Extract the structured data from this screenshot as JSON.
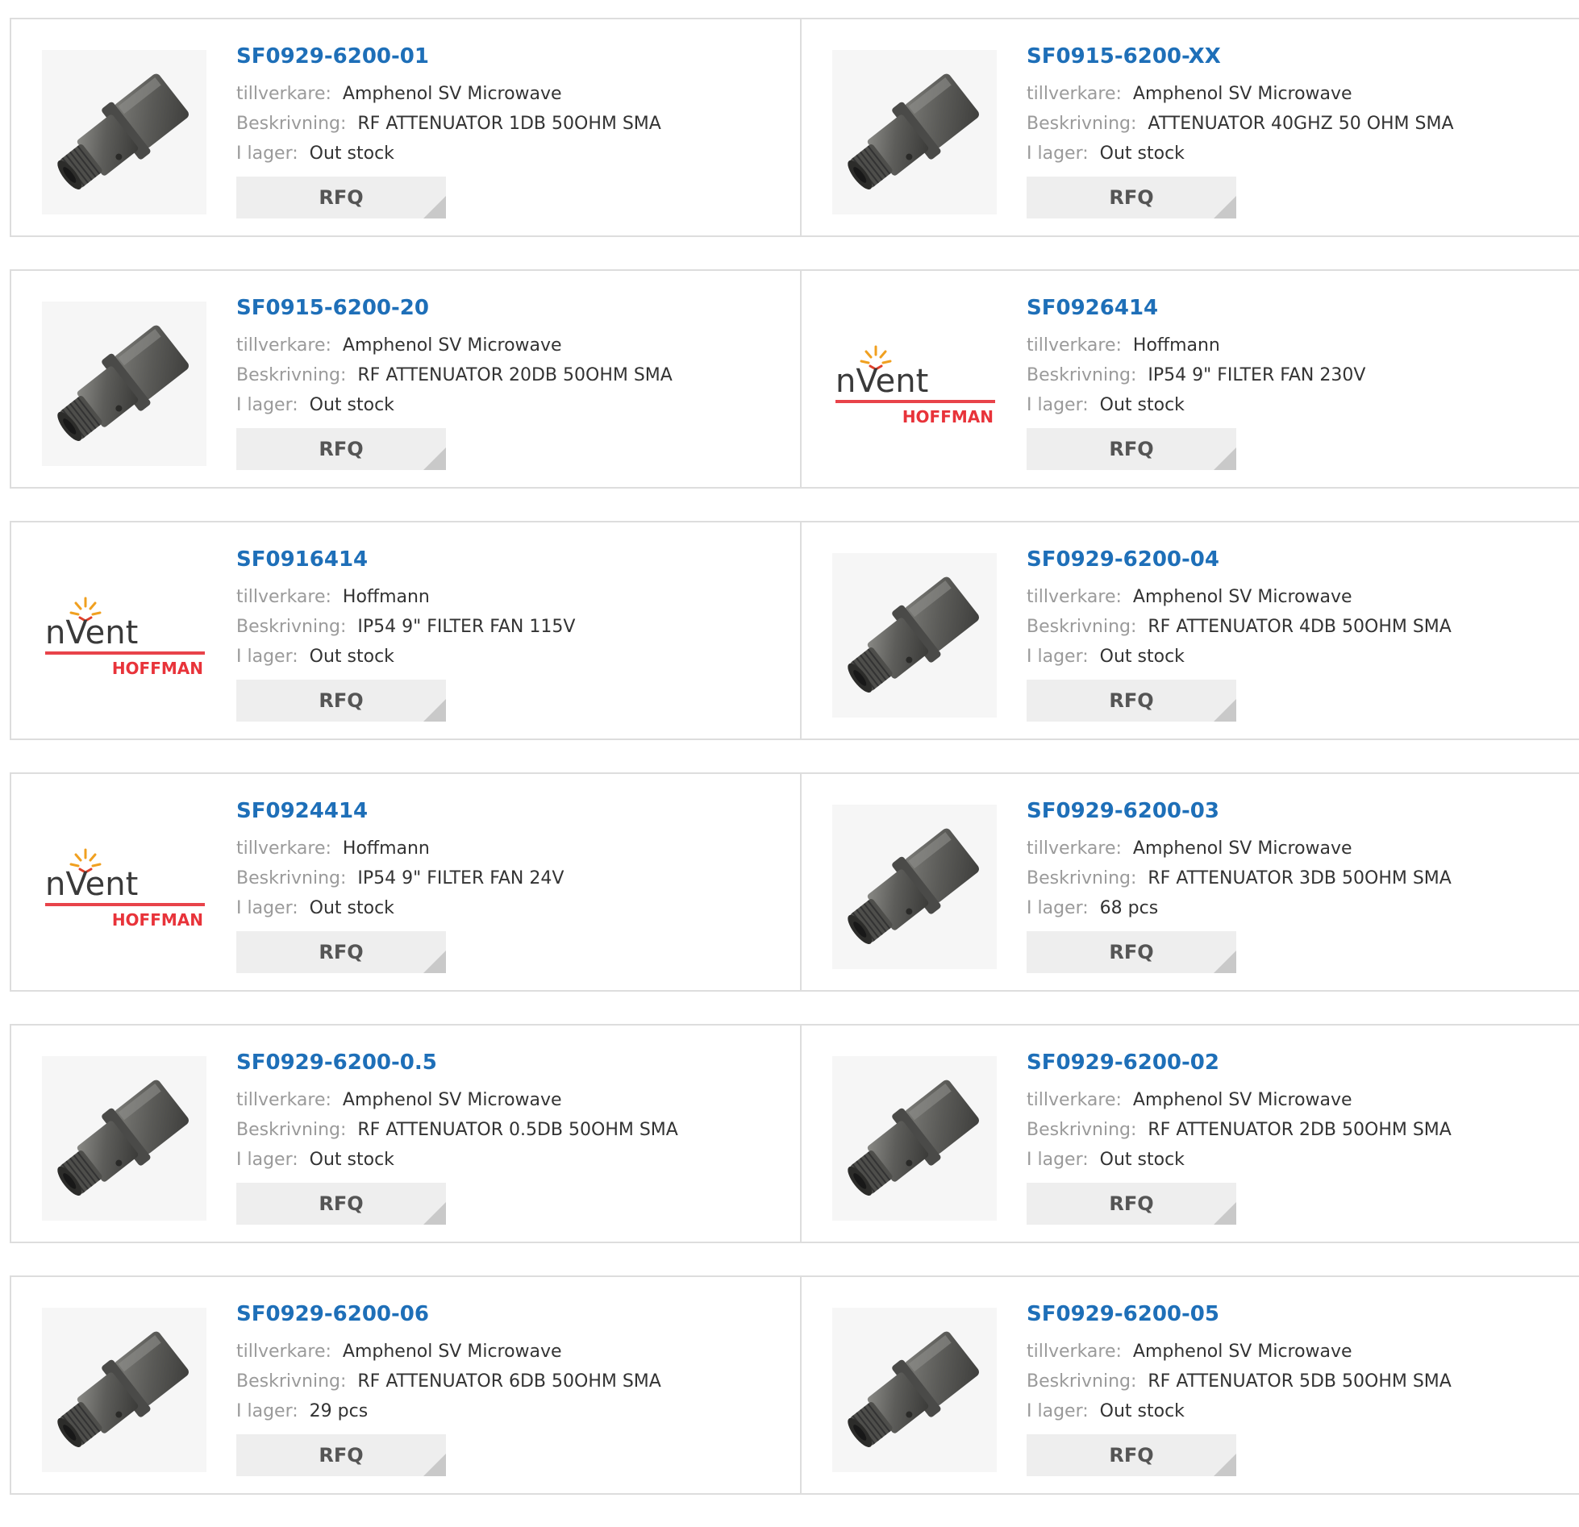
{
  "labels": {
    "manufacturer": "tillverkare:",
    "description": "Beskrivning:",
    "stock": "I lager:",
    "rfq": "RFQ"
  },
  "colors": {
    "part_link": "#1e6fb8",
    "label": "#9a9a9a",
    "value": "#333333",
    "rfq_bg": "#eeeeee",
    "border": "#dddddd"
  },
  "products": [
    {
      "part": "SF0929-6200-01",
      "manufacturer": "Amphenol SV Microwave",
      "description": "RF ATTENUATOR 1DB 50OHM SMA",
      "stock": "Out stock",
      "image": "connector"
    },
    {
      "part": "SF0915-6200-XX",
      "manufacturer": "Amphenol SV Microwave",
      "description": "ATTENUATOR 40GHZ 50 OHM SMA",
      "stock": "Out stock",
      "image": "connector"
    },
    {
      "part": "SF0915-6200-20",
      "manufacturer": "Amphenol SV Microwave",
      "description": "RF ATTENUATOR 20DB 50OHM SMA",
      "stock": "Out stock",
      "image": "connector"
    },
    {
      "part": "SF0926414",
      "manufacturer": "Hoffmann",
      "description": "IP54 9\" FILTER FAN 230V",
      "stock": "Out stock",
      "image": "nvent-logo"
    },
    {
      "part": "SF0916414",
      "manufacturer": "Hoffmann",
      "description": "IP54 9\" FILTER FAN 115V",
      "stock": "Out stock",
      "image": "nvent-logo"
    },
    {
      "part": "SF0929-6200-04",
      "manufacturer": "Amphenol SV Microwave",
      "description": "RF ATTENUATOR 4DB 50OHM SMA",
      "stock": "Out stock",
      "image": "connector"
    },
    {
      "part": "SF0924414",
      "manufacturer": "Hoffmann",
      "description": "IP54 9\" FILTER FAN 24V",
      "stock": "Out stock",
      "image": "nvent-logo"
    },
    {
      "part": "SF0929-6200-03",
      "manufacturer": "Amphenol SV Microwave",
      "description": "RF ATTENUATOR 3DB 50OHM SMA",
      "stock": "68 pcs",
      "image": "connector"
    },
    {
      "part": "SF0929-6200-0.5",
      "manufacturer": "Amphenol SV Microwave",
      "description": "RF ATTENUATOR 0.5DB 50OHM SMA",
      "stock": "Out stock",
      "image": "connector"
    },
    {
      "part": "SF0929-6200-02",
      "manufacturer": "Amphenol SV Microwave",
      "description": "RF ATTENUATOR 2DB 50OHM SMA",
      "stock": "Out stock",
      "image": "connector"
    },
    {
      "part": "SF0929-6200-06",
      "manufacturer": "Amphenol SV Microwave",
      "description": "RF ATTENUATOR 6DB 50OHM SMA",
      "stock": "29 pcs",
      "image": "connector"
    },
    {
      "part": "SF0929-6200-05",
      "manufacturer": "Amphenol SV Microwave",
      "description": "RF ATTENUATOR 5DB 50OHM SMA",
      "stock": "Out stock",
      "image": "connector"
    }
  ],
  "logo": {
    "brand": "nVent",
    "sub": "HOFFMAN"
  }
}
